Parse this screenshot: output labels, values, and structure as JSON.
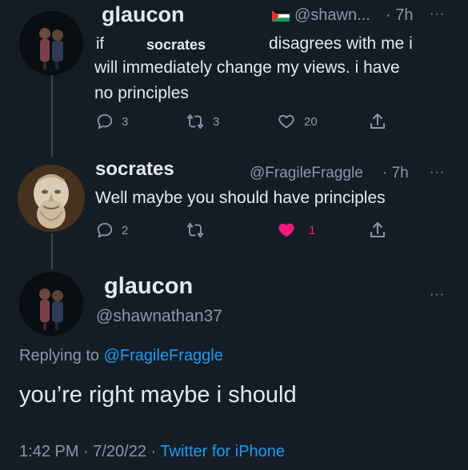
{
  "tweet1": {
    "name": "glaucon",
    "handle": "@shawn...",
    "time": "· 7h",
    "text_if": "if",
    "text_name": "socrates",
    "text_rest": "disagrees with me i",
    "text_line2": "will immediately change my views. i have",
    "text_line3": "no principles",
    "replies": "3",
    "retweets": "3",
    "likes": "20"
  },
  "tweet2": {
    "name": "socrates",
    "handle": "@FragileFraggle",
    "time": "· 7h",
    "text": "Well maybe you should have principles",
    "replies": "2",
    "likes": "1",
    "like_color": "#f91880"
  },
  "tweet3": {
    "name": "glaucon",
    "handle": "@shawnathan37",
    "replying_prefix": "Replying to",
    "replying_to": "@FragileFraggle",
    "text": "you’re right maybe i should",
    "timestamp": "1:42 PM · 7/20/22 ·",
    "source": "Twitter for iPhone"
  },
  "icons": {
    "more": "···",
    "reply": "reply-icon",
    "retweet": "retweet-icon",
    "like": "heart-icon",
    "share": "share-icon",
    "flag": "palestine-flag-icon"
  },
  "colors": {
    "background": "#141d26",
    "link": "#1d9bf0",
    "muted": "#8b98a5"
  }
}
